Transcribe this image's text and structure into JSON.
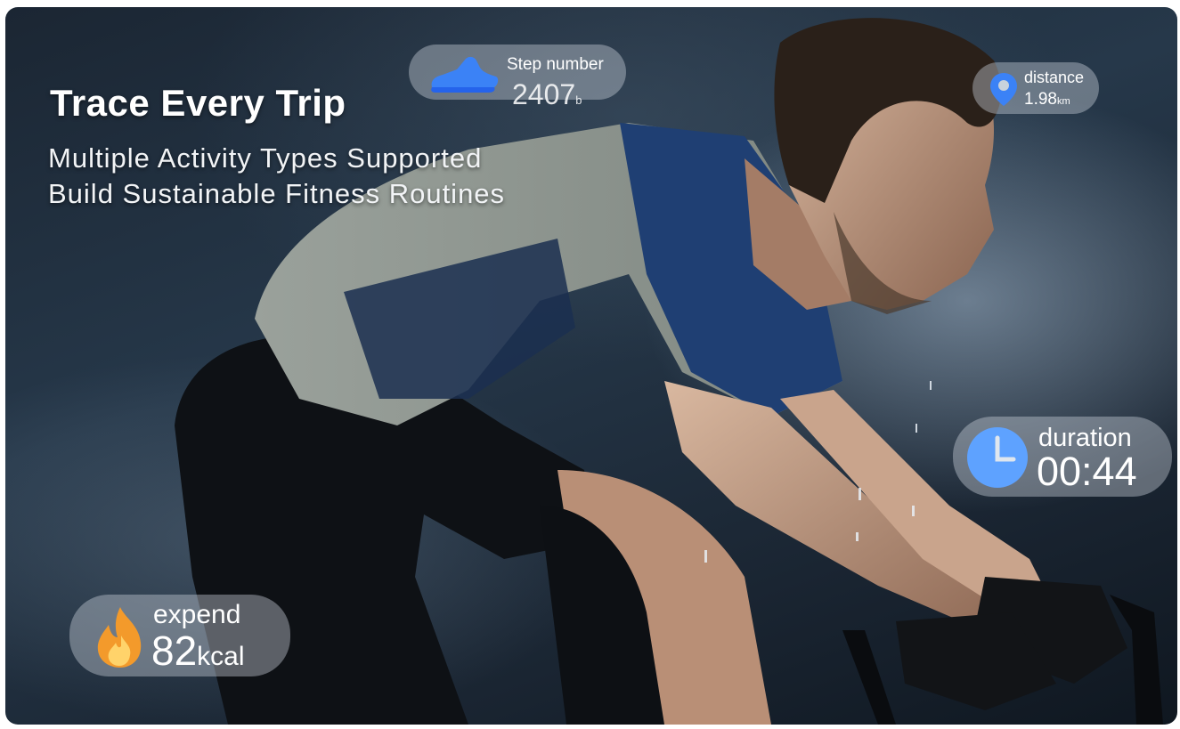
{
  "banner": {
    "headline": "Trace Every Trip",
    "subline_1": "Multiple Activity Types Supported",
    "subline_2": "Build Sustainable Fitness Routines"
  },
  "stats": {
    "steps": {
      "label": "Step number",
      "value": "2407",
      "unit": "b",
      "icon": "shoe-icon"
    },
    "distance": {
      "label": "distance",
      "value": "1.98",
      "unit": "km",
      "icon": "location-pin-icon"
    },
    "duration": {
      "label": "duration",
      "value": "00:44",
      "icon": "clock-icon"
    },
    "calories": {
      "label": "expend",
      "value": "82",
      "unit": "kcal",
      "icon": "flame-icon"
    }
  },
  "colors": {
    "accent_blue": "#3b82f6",
    "clock_blue": "#5ea2ff",
    "flame_orange": "#f39a2b",
    "pill_bg": "rgba(200,208,216,0.42)"
  }
}
